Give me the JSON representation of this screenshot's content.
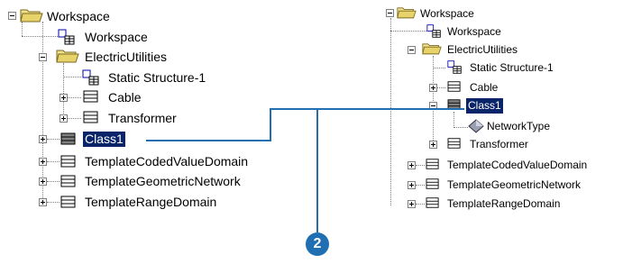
{
  "left_tree": {
    "root": "Workspace",
    "workspace": "Workspace",
    "electric": "ElectricUtilities",
    "static": "Static Structure-1",
    "cable": "Cable",
    "transformer": "Transformer",
    "class1": "Class1",
    "coded": "TemplateCodedValueDomain",
    "geometric": "TemplateGeometricNetwork",
    "range": "TemplateRangeDomain"
  },
  "right_tree": {
    "root": "Workspace",
    "workspace": "Workspace",
    "electric": "ElectricUtilities",
    "static": "Static Structure-1",
    "cable": "Cable",
    "class1": "Class1",
    "network_type": "NetworkType",
    "transformer": "Transformer",
    "coded": "TemplateCodedValueDomain",
    "geometric": "TemplateGeometricNetwork",
    "range": "TemplateRangeDomain"
  },
  "callout": {
    "number": "2"
  },
  "colors": {
    "selection": "#0a246a",
    "callout": "#1f6fb2",
    "folder": "#f2e08a"
  }
}
